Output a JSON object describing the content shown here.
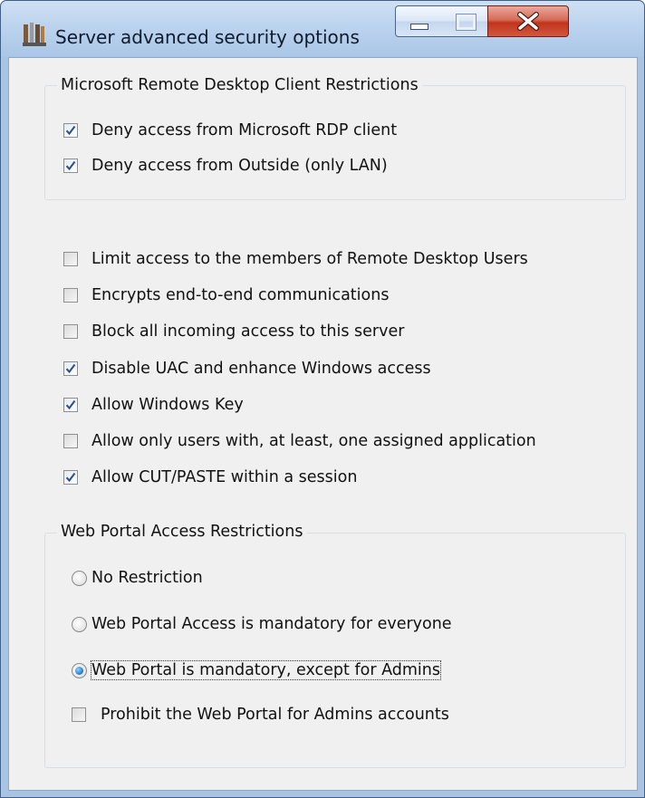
{
  "window": {
    "title": "Server advanced security options"
  },
  "rdp_group": {
    "legend": "Microsoft Remote Desktop Client Restrictions",
    "options": [
      {
        "label": "Deny access from Microsoft RDP client",
        "checked": true
      },
      {
        "label": "Deny access from Outside (only LAN)",
        "checked": true
      }
    ]
  },
  "general_options": [
    {
      "label": "Limit access to the members of Remote Desktop Users",
      "checked": false
    },
    {
      "label": "Encrypts end-to-end communications",
      "checked": false
    },
    {
      "label": "Block all incoming access to this server",
      "checked": false
    },
    {
      "label": "Disable UAC and enhance Windows access",
      "checked": true
    },
    {
      "label": "Allow Windows Key",
      "checked": true
    },
    {
      "label": "Allow only users with, at least, one assigned application",
      "checked": false
    },
    {
      "label": "Allow CUT/PASTE within a session",
      "checked": true
    }
  ],
  "web_portal_group": {
    "legend": "Web Portal Access Restrictions",
    "radios": [
      {
        "label": "No Restriction",
        "selected": false
      },
      {
        "label": "Web Portal Access is mandatory for everyone",
        "selected": false
      },
      {
        "label": "Web Portal is mandatory, except for Admins",
        "selected": true
      }
    ],
    "checkbox": {
      "label": "Prohibit the Web Portal for Admins accounts",
      "checked": false
    }
  },
  "icons": {
    "app": "tools-icon",
    "minimize": "minimize-icon",
    "maximize": "maximize-icon",
    "close": "close-icon",
    "check": "checkmark-icon"
  },
  "colors": {
    "titlebar": "#bcd3ee",
    "client_bg": "#f0f0f0",
    "close_button": "#c1341c",
    "radio_selected": "#1e77c9"
  }
}
